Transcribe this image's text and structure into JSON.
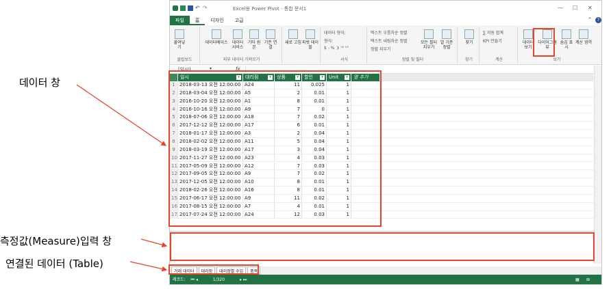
{
  "annotations": {
    "data_window": "데이터 창",
    "measure_window": "측정값(Measure)입력 창",
    "linked_table": "연결된 데이터 (Table)"
  },
  "titlebar": {
    "title": "Excel용 Power Pivot - 통합 문서1",
    "min": "—",
    "max": "☐",
    "close": "✕",
    "collapse": "^",
    "help": "?"
  },
  "tabs": [
    "파일",
    "홈",
    "디자인",
    "고급"
  ],
  "ribbon": {
    "paste": "붙여넣기",
    "clipboard_label": "클립보드",
    "db": "데이터베이스",
    "data_service": "데이터 서비스",
    "other": "기타 원본",
    "existing": "기존 연결",
    "external_label": "외부 데이터 가져오기",
    "refresh": "새로 고침",
    "pivot": "피벗 테이블",
    "format_type": "데이터 형식:",
    "format": "형식:",
    "currency": "$ - % ❩ ⁰⁰ ⁰⁰",
    "format_label": "서식",
    "sort_asc": "텍스트 오름차순 정렬",
    "sort_desc": "텍스트 내림차순 정렬",
    "clear_sort": "정렬 지우기",
    "clear_filter": "모든 필터 지우기",
    "sort_by_col": "열 기준 정렬",
    "sort_filter_label": "정렬 및 필터",
    "find": "찾기",
    "find_label": "찾기",
    "autosum": "∑ 자동 합계",
    "kpi": "KPI 만들기",
    "calc_label": "계산",
    "data_view": "데이터 보기",
    "diagram_view": "다이어그램 뷰",
    "hidden": "숨김 표시",
    "calc_area": "계산 영역",
    "view_label": "보기"
  },
  "formula_bar": {
    "cell": "[일시]",
    "fx": "fx"
  },
  "columns": [
    "일시",
    "대리점",
    "상품",
    "할인",
    "Unit",
    "열 추가"
  ],
  "rows": [
    [
      "1",
      "2018-03-13 오전 12:00:00",
      "A24",
      "11",
      "0.025",
      "1"
    ],
    [
      "2",
      "2018-03-04 오전 12:00:00",
      "A5",
      "2",
      "0.01",
      "1"
    ],
    [
      "3",
      "2016-10-20 오전 12:00:00",
      "A1",
      "8",
      "0.01",
      "1"
    ],
    [
      "4",
      "2016-10-16 오전 12:00:00",
      "A9",
      "7",
      "0",
      "1"
    ],
    [
      "5",
      "2018-07-06 오전 12:00:00",
      "A18",
      "7",
      "0.02",
      "1"
    ],
    [
      "6",
      "2017-12-12 오전 12:00:00",
      "A17",
      "6",
      "0.01",
      "1"
    ],
    [
      "7",
      "2018-01-17 오전 12:00:00",
      "A3",
      "2",
      "0.04",
      "1"
    ],
    [
      "8",
      "2018-02-02 오전 12:00:00",
      "A11",
      "5",
      "0.04",
      "1"
    ],
    [
      "9",
      "2018-03-19 오전 12:00:00",
      "A17",
      "3",
      "0.04",
      "1"
    ],
    [
      "10",
      "2017-11-27 오전 12:00:00",
      "A23",
      "4",
      "0.03",
      "1"
    ],
    [
      "11",
      "2017-05-09 오전 12:00:00",
      "A12",
      "7",
      "0.03",
      "1"
    ],
    [
      "12",
      "2017-09-05 오전 12:00:00",
      "A9",
      "7",
      "0.02",
      "1"
    ],
    [
      "13",
      "2017-12-05 오전 12:00:00",
      "A10",
      "8",
      "0.01",
      "1"
    ],
    [
      "14",
      "2018-02-26 오전 12:00:00",
      "A16",
      "8",
      "0.01",
      "1"
    ],
    [
      "15",
      "2017-06-17 오전 12:00:00",
      "A9",
      "11",
      "0.02",
      "1"
    ],
    [
      "16",
      "2017-08-15 오전 12:00:00",
      "A7",
      "4",
      "0.01",
      "1"
    ],
    [
      "17",
      "2017-07-24 오전 12:00:00",
      "A24",
      "12",
      "0.03",
      "1"
    ]
  ],
  "sheet_tabs": [
    "거래 데이터",
    "대리점",
    "대리점별 수입",
    "품목"
  ],
  "status": {
    "label": "레코드:",
    "position": "1/320"
  },
  "colors": {
    "accent": "#217346",
    "highlight": "#e8432b"
  }
}
